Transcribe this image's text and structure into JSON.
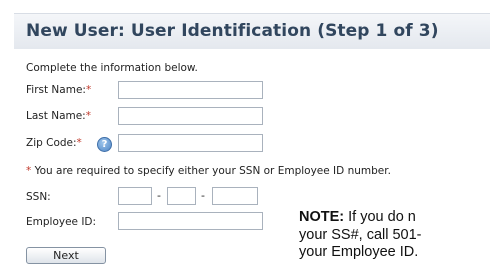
{
  "header": {
    "title": "New User: User Identification (Step 1 of 3)"
  },
  "instructions": "Complete the information below.",
  "fields": {
    "first_name": {
      "label": "First Name:",
      "required_marker": "*",
      "value": ""
    },
    "last_name": {
      "label": "Last Name:",
      "required_marker": "*",
      "value": ""
    },
    "zip_code": {
      "label": "Zip Code:",
      "required_marker": "*",
      "value": "",
      "help_icon": "help-icon"
    },
    "ssn": {
      "label": "SSN:",
      "part1": "",
      "part2": "",
      "part3": "",
      "separator": "-"
    },
    "employee_id": {
      "label": "Employee ID:",
      "value": ""
    }
  },
  "requirement_note": {
    "marker": "*",
    "text": " You are required to specify either your SSN or Employee ID number."
  },
  "buttons": {
    "next_label": "Next"
  },
  "note": {
    "heading": "NOTE:",
    "line1": " If you do n",
    "line2": "your SS#, call 501-",
    "line3": "your Employee ID."
  },
  "colors": {
    "title": "#31465e",
    "required": "#c0392b",
    "header_bg": "#e4e8ee"
  }
}
